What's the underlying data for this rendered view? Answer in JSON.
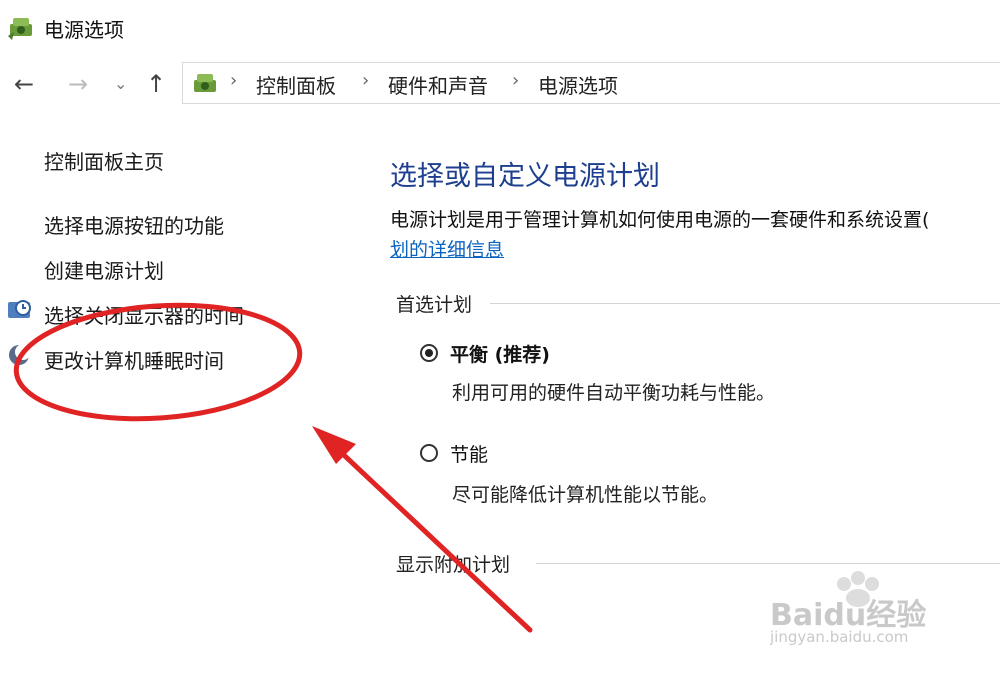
{
  "window": {
    "title": "电源选项"
  },
  "address": {
    "crumbs": [
      "控制面板",
      "硬件和声音",
      "电源选项"
    ]
  },
  "sidebar": {
    "home": "控制面板主页",
    "items": [
      "选择电源按钮的功能",
      "创建电源计划",
      "选择关闭显示器的时间",
      "更改计算机睡眠时间"
    ]
  },
  "main": {
    "heading": "选择或自定义电源计划",
    "description": "电源计划是用于管理计算机如何使用电源的一套硬件和系统设置(",
    "details_link": "划的详细信息",
    "preferred_label": "首选计划",
    "plans": [
      {
        "name": "平衡 (推荐)",
        "desc": "利用可用的硬件自动平衡功耗与性能。",
        "selected": true
      },
      {
        "name": "节能",
        "desc": "尽可能降低计算机性能以节能。",
        "selected": false
      }
    ],
    "extra_label": "显示附加计划"
  },
  "watermark": {
    "brand": "Baidu经验",
    "url": "jingyan.baidu.com"
  },
  "colors": {
    "heading": "#1e3f8f",
    "link": "#0b63c1",
    "annotation": "#e02424"
  }
}
